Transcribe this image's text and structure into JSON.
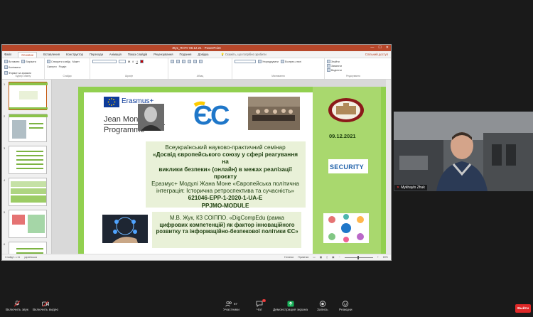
{
  "ppt": {
    "window_title": "Жук_ПНГУ 08.12.21 - PowerPoint",
    "tabs": [
      "Файл",
      "Основне",
      "Вставлення",
      "Конструктор",
      "Переходи",
      "Анімація",
      "Показ слайдів",
      "Рецензування",
      "Подання",
      "Довідка"
    ],
    "search": "Скажіть, що потрібно зробити",
    "share": "Спільний доступ",
    "ribbon": {
      "clipboard": {
        "label": "Буфер обміну",
        "paste": "Вставити",
        "cut": "Вирізати",
        "copy": "Копіювати",
        "format": "Формат за зразком"
      },
      "slides": {
        "label": "Слайди",
        "new_slide": "Створити слайд",
        "layout": "Макет",
        "reset": "Скинути",
        "section": "Розділ"
      },
      "font": {
        "label": "Шрифт"
      },
      "paragraph": {
        "label": "Абзац"
      },
      "drawing": {
        "label": "Малювання",
        "arrange": "Упорядкувати",
        "quick_styles": "Експрес-стилі"
      },
      "editing": {
        "label": "Редагування",
        "find": "Знайти",
        "replace": "Замінити",
        "select": "Виділити"
      }
    },
    "status": {
      "slide": "Слайд 1 з 11",
      "lang": "українська",
      "notes": "Нотатки",
      "comments": "Примітки",
      "zoom": "69%"
    },
    "thumb_numbers": [
      "1",
      "2",
      "3",
      "4",
      "5",
      "6",
      "7"
    ]
  },
  "slide": {
    "erasmus": "Erasmus+",
    "jean_monnet_1": "Jean Monnet",
    "jean_monnet_2": "Programme",
    "ec_logo": "ЄС",
    "date": "09.12.2021",
    "security": "SECURITY",
    "title_lines": [
      "Всеукраїнський науково-практичний семінар",
      "«Досвід європейського союзу у сфері реагування на",
      "виклики безпеки» (онлайн) в межах реалізації проєкту",
      "Еразмус+ Модулі  Жана Моне «Європейська політична",
      "інтеграція: Історична ретроспектива та сучасність»",
      "621046-EPP-1-2020-1-UA-E",
      "PPJMO-MODULE"
    ],
    "author_lines": [
      "М.В. Жук, КЗ СОІППО. «DigCompEdu (рамка",
      "цифрових компетенцій) як фактор інноваційного",
      "розвитку та  інформаційно-безпекової політики ЄС»"
    ]
  },
  "video": {
    "name": "Mykhaylo Zhuk"
  },
  "toolbar": {
    "mute": "Включить звук",
    "video": "Включить видео",
    "participants": "Участники",
    "participants_count": "57",
    "chat": "Чат",
    "chat_badge": "1",
    "share": "Демонстрация экрана",
    "record": "Запись",
    "reactions": "Реакции",
    "exit": "Выйти"
  },
  "colors": {
    "ppt_accent": "#b7472a",
    "slide_green": "#92d050",
    "share_green": "#19b35a",
    "exit_red": "#e02828"
  }
}
